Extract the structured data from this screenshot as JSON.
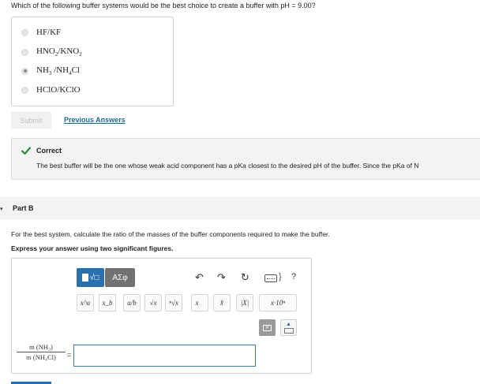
{
  "question": "Which of the following buffer systems would be the best choice to create a buffer with pH = 9.00?",
  "choices": [
    {
      "label_html": "HF/KF",
      "selected": false
    },
    {
      "label_html": "HNO<sub>2</sub>/KNO<sub>2</sub>",
      "selected": false
    },
    {
      "label_html": "NH<sub>3</sub> /NH<sub>4</sub>Cl",
      "selected": true
    },
    {
      "label_html": "HClO/KClO",
      "selected": false
    }
  ],
  "submit_label": "Submit",
  "previous_answers_label": "Previous Answers",
  "feedback": {
    "title": "Correct",
    "text": "The best buffer will be the one whose weak acid component has a pKa closest to the desired pH of the buffer. Since the pKa of N"
  },
  "part_b": {
    "title": "Part B",
    "question": "For the best system, calculate the ratio of the masses of the buffer components required to make the buffer.",
    "instruction": "Express your answer using two significant figures."
  },
  "toolbar": {
    "template_sqrt": "√□",
    "greek_label": "ΑΣφ",
    "undo": "↶",
    "redo": "↷",
    "reset": "↻",
    "keyboard_close": "}",
    "help": "?"
  },
  "keys": [
    "x^a",
    "x_b",
    "a/b",
    "√x",
    "ⁿ√x",
    "x⃗",
    "x̂",
    "|X|",
    "x·10ⁿ"
  ],
  "ratio": {
    "numerator": "m (NH₃)",
    "denominator": "m (NH₄Cl)",
    "equals": "="
  },
  "answer": {
    "value": ""
  }
}
